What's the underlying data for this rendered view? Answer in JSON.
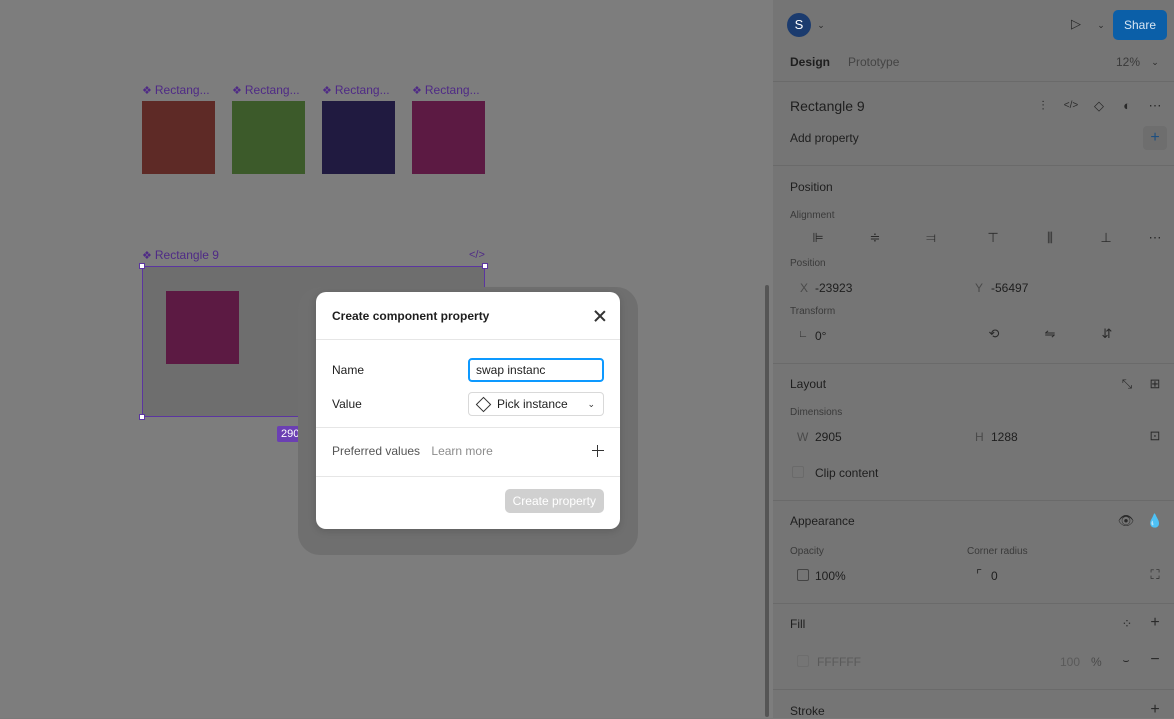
{
  "canvas": {
    "components": [
      {
        "label": "Rectang...",
        "color": "#5e2a26"
      },
      {
        "label": "Rectang...",
        "color": "#3c5a2a"
      },
      {
        "label": "Rectang...",
        "color": "#201a40"
      },
      {
        "label": "Rectang...",
        "color": "#5c1a43"
      }
    ],
    "selected_label": "Rectangle 9",
    "dimension_badge": "2905 ×"
  },
  "modal": {
    "title": "Create component property",
    "name_label": "Name",
    "name_value": "swap instanc",
    "value_label": "Value",
    "value_select": "Pick instance",
    "preferred_label": "Preferred values",
    "learn_more": "Learn more",
    "create_button": "Create property"
  },
  "topbar": {
    "avatar_letter": "S",
    "share": "Share",
    "tabs": [
      "Design",
      "Prototype"
    ],
    "zoom": "12%"
  },
  "panel": {
    "layer_name": "Rectangle 9",
    "add_property": "Add property",
    "position": {
      "title": "Position",
      "alignment_label": "Alignment",
      "position_label": "Position",
      "x_label": "X",
      "x_value": "-23923",
      "y_label": "Y",
      "y_value": "-56497",
      "transform_label": "Transform",
      "rotation": "0°"
    },
    "layout": {
      "title": "Layout",
      "dimensions_label": "Dimensions",
      "w_label": "W",
      "w_value": "2905",
      "h_label": "H",
      "h_value": "1288",
      "clip_content": "Clip content"
    },
    "appearance": {
      "title": "Appearance",
      "opacity_label": "Opacity",
      "opacity_value": "100%",
      "radius_label": "Corner radius",
      "radius_value": "0"
    },
    "fill": {
      "title": "Fill",
      "hex": "FFFFFF",
      "opacity": "100",
      "percent": "%"
    },
    "stroke": {
      "title": "Stroke"
    }
  }
}
